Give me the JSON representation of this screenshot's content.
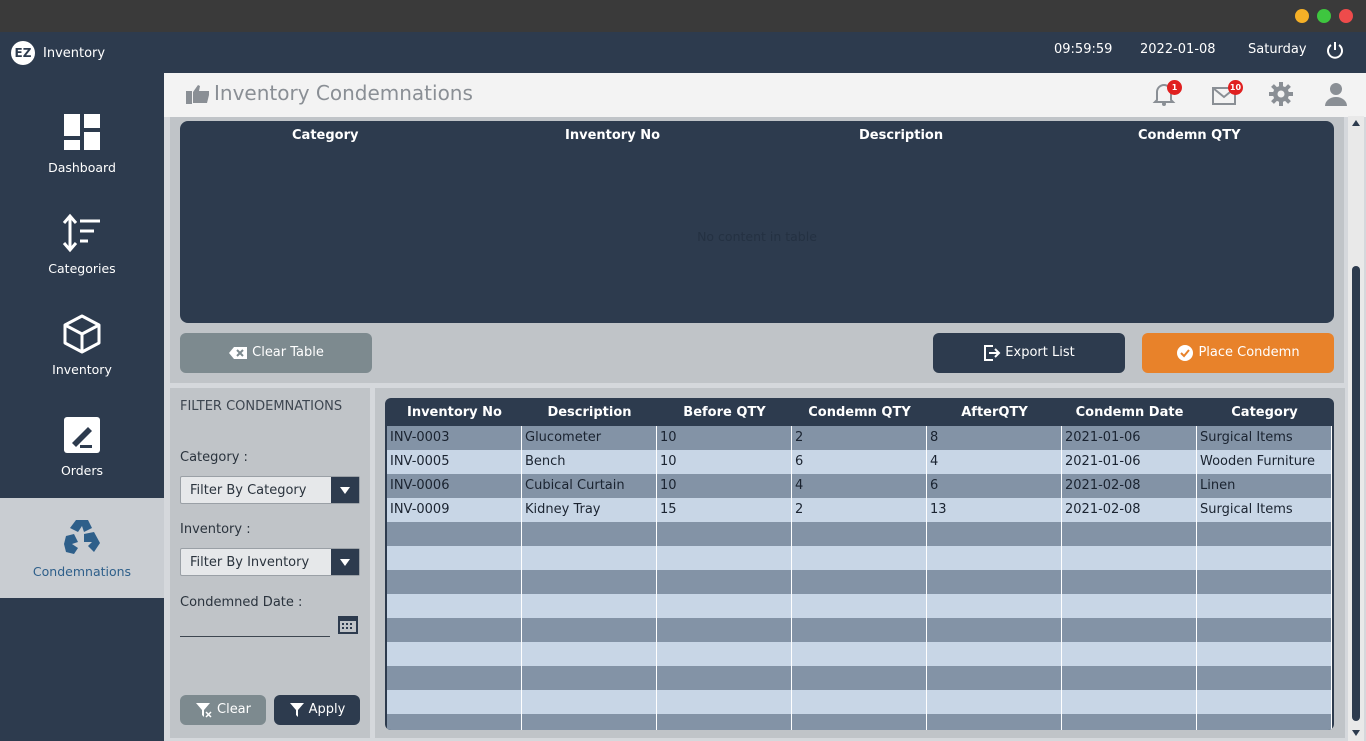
{
  "app": {
    "title": "Inventory",
    "logo": "EZ"
  },
  "clock": {
    "time": "09:59:59",
    "date": "2022-01-08",
    "day": "Saturday"
  },
  "sidebar": {
    "items": [
      {
        "label": "Dashboard",
        "icon": "dashboard-icon",
        "active": false
      },
      {
        "label": "Categories",
        "icon": "sort-icon",
        "active": false
      },
      {
        "label": "Inventory",
        "icon": "box-icon",
        "active": false
      },
      {
        "label": "Orders",
        "icon": "edit-icon",
        "active": false
      },
      {
        "label": "Condemnations",
        "icon": "recycle-icon",
        "active": true
      }
    ]
  },
  "header": {
    "title": "Inventory Condemnations",
    "notifications": "1",
    "messages": "10"
  },
  "condemn_table": {
    "columns": [
      "Category",
      "Inventory No",
      "Description",
      "Condemn QTY"
    ],
    "empty_text": "No content in table"
  },
  "buttons": {
    "clear_table": "Clear Table",
    "export_list": "Export List",
    "place_condemn": "Place Condemn"
  },
  "filter": {
    "heading": "FILTER CONDEMNATIONS",
    "category_label": "Category :",
    "category_value": "Filter By Category",
    "inventory_label": "Inventory :",
    "inventory_value": "Filter By Inventory",
    "date_label": "Condemned Date :",
    "clear": "Clear",
    "apply": "Apply"
  },
  "history_table": {
    "columns": [
      "Inventory No",
      "Description",
      "Before QTY",
      "Condemn QTY",
      "AfterQTY",
      "Condemn Date",
      "Category"
    ],
    "rows": [
      [
        "INV-0003",
        "Glucometer",
        "10",
        "2",
        "8",
        "2021-01-06",
        "Surgical Items"
      ],
      [
        "INV-0005",
        "Bench",
        "10",
        "6",
        "4",
        "2021-01-06",
        "Wooden Furniture"
      ],
      [
        "INV-0006",
        "Cubical Curtain",
        "10",
        "4",
        "6",
        "2021-02-08",
        "Linen"
      ],
      [
        "INV-0009",
        "Kidney Tray",
        "15",
        "2",
        "13",
        "2021-02-08",
        "Surgical Items"
      ]
    ]
  },
  "colors": {
    "sidebar": "#2d3b4e",
    "accent": "#e8822a",
    "row_dark": "#8393a6",
    "row_light": "#c8d6e6"
  }
}
